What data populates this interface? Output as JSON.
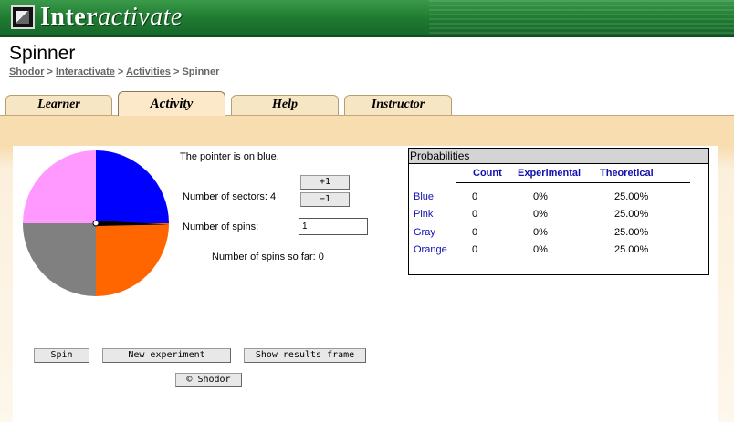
{
  "banner": {
    "brand_bold": "Inter",
    "brand_italic": "activate"
  },
  "page": {
    "title": "Spinner"
  },
  "breadcrumb": {
    "items": [
      "Shodor",
      "Interactivate",
      "Activities",
      "Spinner"
    ],
    "sep": " > "
  },
  "tabs": [
    {
      "label": "Learner",
      "active": false
    },
    {
      "label": "Activity",
      "active": true
    },
    {
      "label": "Help",
      "active": false
    },
    {
      "label": "Instructor",
      "active": false
    }
  ],
  "spinner": {
    "sectors": [
      {
        "name": "Blue",
        "color": "#0000ff"
      },
      {
        "name": "Orange",
        "color": "#ff6600"
      },
      {
        "name": "Gray",
        "color": "#808080"
      },
      {
        "name": "Pink",
        "color": "#ff99ff"
      }
    ],
    "pointer_angle_deg": 91
  },
  "controls": {
    "pointer_status": "The pointer is on blue.",
    "plus_label": "+1",
    "minus_label": "−1",
    "sectors_label": "Number of sectors: 4",
    "spins_label": "Number of spins:",
    "spins_value": "1",
    "spins_so_far": "Number of spins so far: 0"
  },
  "probabilities": {
    "title": "Probabilities",
    "headers": [
      "Count",
      "Experimental",
      "Theoretical"
    ],
    "rows": [
      {
        "name": "Blue",
        "count": "0",
        "experimental": "0%",
        "theoretical": "25.00%"
      },
      {
        "name": "Pink",
        "count": "0",
        "experimental": "0%",
        "theoretical": "25.00%"
      },
      {
        "name": "Gray",
        "count": "0",
        "experimental": "0%",
        "theoretical": "25.00%"
      },
      {
        "name": "Orange",
        "count": "0",
        "experimental": "0%",
        "theoretical": "25.00%"
      }
    ]
  },
  "buttons": {
    "spin": "Spin",
    "new_experiment": "New experiment",
    "show_results": "Show results frame",
    "copyright": "© Shodor"
  }
}
